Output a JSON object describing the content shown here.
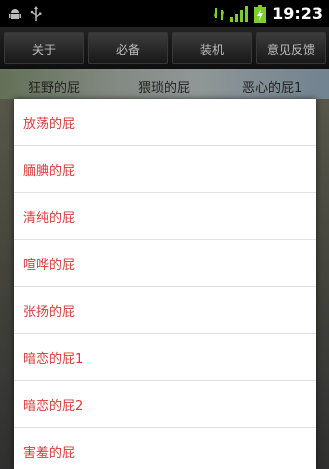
{
  "status_bar": {
    "time": "19:23",
    "icons": [
      "android-debug-icon",
      "usb-icon",
      "signal-type-icon",
      "signal-bars-icon",
      "battery-charging-icon"
    ]
  },
  "menu": {
    "buttons": [
      {
        "label": "关于"
      },
      {
        "label": "必备"
      },
      {
        "label": "装机"
      },
      {
        "label": "意见反馈"
      }
    ]
  },
  "tabs": {
    "items": [
      {
        "label": "狂野的屁"
      },
      {
        "label": "猥琐的屁"
      },
      {
        "label": "恶心的屁1"
      }
    ]
  },
  "list": {
    "items": [
      {
        "label": "放荡的屁"
      },
      {
        "label": "腼腆的屁"
      },
      {
        "label": "清纯的屁"
      },
      {
        "label": "喧哗的屁"
      },
      {
        "label": "张扬的屁"
      },
      {
        "label": "暗恋的屁1"
      },
      {
        "label": "暗恋的屁2"
      },
      {
        "label": "害羞的屁"
      }
    ]
  },
  "colors": {
    "list_text": "#d83a3a",
    "status_bar_bg": "#000000",
    "battery_green": "#7ccf2a"
  }
}
